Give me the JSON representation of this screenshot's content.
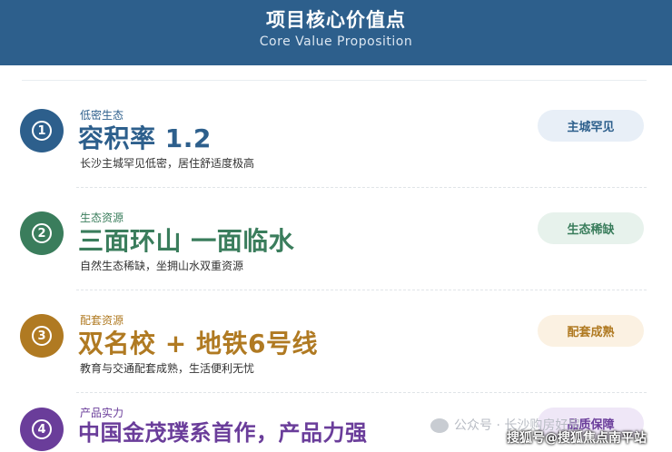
{
  "header": {
    "title": "项目核心价值点",
    "subtitle": "Core Value Proposition"
  },
  "items": [
    {
      "num": "1",
      "tag": "低密生态",
      "title": "容积率 1.2",
      "desc": "长沙主城罕见低密，居住舒适度极高",
      "pill": "主城罕见",
      "color": "#2d5f8c",
      "pill_bg": "#e8eff7"
    },
    {
      "num": "2",
      "tag": "生态资源",
      "title": "三面环山 一面临水",
      "desc": "自然生态稀缺，坐拥山水双重资源",
      "pill": "生态稀缺",
      "color": "#3a7d5c",
      "pill_bg": "#e7f2ec"
    },
    {
      "num": "3",
      "tag": "配套资源",
      "title": "双名校 + 地铁6号线",
      "desc": "教育与交通配套成熟，生活便利无忧",
      "pill": "配套成熟",
      "color": "#b07a22",
      "pill_bg": "#fbf1e2"
    },
    {
      "num": "4",
      "tag": "产品实力",
      "title": "中国金茂璞系首作，产品力强",
      "desc": "",
      "pill": "品质保障",
      "color": "#6a3d9a",
      "pill_bg": "#efe7f7"
    }
  ],
  "watermark": {
    "text": "公众号 · 长沙购房好房",
    "text2": "搜狐号@搜狐焦点南平站"
  }
}
